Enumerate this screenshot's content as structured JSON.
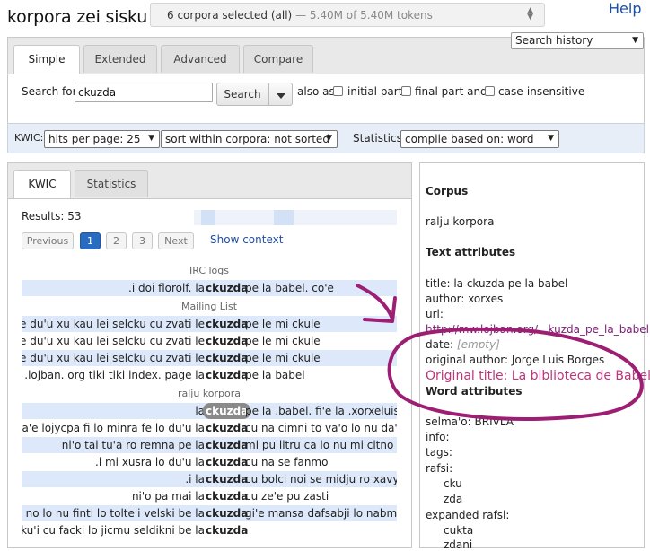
{
  "header": {
    "title": "korpora zei sisku",
    "corpus_selected": "6 corpora selected (all)",
    "corpus_tokens": "— 5.40M of 5.40M tokens",
    "help": "Help"
  },
  "search_history": {
    "label": "Search history"
  },
  "search_tabs": [
    "Simple",
    "Extended",
    "Advanced",
    "Compare"
  ],
  "search": {
    "label": "Search for",
    "value": "ckuzda",
    "button": "Search",
    "also_as": "also as",
    "opt_initial": "initial part",
    "opt_final": "final part and",
    "opt_case": "case-insensitive"
  },
  "options_bar": {
    "kwic_label": "KWIC:",
    "hits_per_page": "hits per page: 25",
    "sort": "sort within corpora: not sorted",
    "stats_label": "Statistics:",
    "stats": "compile based on: word"
  },
  "kwic_tabs": [
    "KWIC",
    "Statistics"
  ],
  "results": {
    "label": "Results: 53",
    "pagination": {
      "previous": "Previous",
      "pages": [
        "1",
        "2",
        "3"
      ],
      "active_page": "1",
      "next": "Next"
    },
    "show_context": "Show context"
  },
  "kwic_groups": [
    {
      "label": "IRC logs",
      "rows": [
        {
          "left": ".i doi florolf. la",
          "match": "ckuzda",
          "right": "pe la babel. co'e"
        }
      ]
    },
    {
      "label": "Mailing List",
      "rows": [
        {
          "left": "na le du'u xu kau lei selcku cu zvati le",
          "match": "ckuzda",
          "right": "pe le mi ckule"
        },
        {
          "left": "na le du'u xu kau lei selcku cu zvati le",
          "match": "ckuzda",
          "right": "pe le mi ckule"
        },
        {
          "left": "na le du'u xu kau lei selcku cu zvati le",
          "match": "ckuzda",
          "right": "pe le mi ckule"
        },
        {
          "left": "a'oi .lojban. org tiki tiki index. page la",
          "match": "ckuzda",
          "right": "pe la babel"
        }
      ]
    },
    {
      "label": "ralju korpora",
      "rows": [
        {
          "left": "la",
          "match": "ckuzda",
          "right": "pe la .babel. fi'e la .xorxeluis. bo"
        },
        {
          "left": "cu ta'e lojycpa fi lo minra fe lo du'u la",
          "match": "ckuzda",
          "right": "cu na cimni to va'o lo nu da'i ja"
        },
        {
          "left": "ni'o tai tu'a ro remna pe la",
          "match": "ckuzda",
          "right": "mi pu litru ca lo nu mi citno"
        },
        {
          "left": ".i mi xusra lo du'u la",
          "match": "ckuzda",
          "right": "cu na se fanmo"
        },
        {
          "left": ".i la",
          "match": "ckuzda",
          "right": "cu bolci noi se midju ro xavysel"
        },
        {
          "left": "ni'o pa mai la",
          "match": "ckuzda",
          "right": "cu ze'e pu zasti"
        },
        {
          "left": "ci no no lo nu finti lo tolte'i velski be la",
          "match": "ckuzda",
          "right": "gi'e mansa dafsabji lo nabmi po"
        },
        {
          "left": "zdaku'i cu facki lo jicmu seldikni be la",
          "match": "ckuzda",
          "right": ""
        }
      ]
    }
  ],
  "sidebar": {
    "corpus_heading": "Corpus",
    "corpus_value": "ralju korpora",
    "text_attrs_heading": "Text attributes",
    "title_line": "title: la ckuzda pe la babel",
    "author_line": "author: xorxes",
    "url_label": "url:",
    "url_value": "http://mw.lojban.org/...kuzda_pe_la_babel",
    "date_label": "date:",
    "date_value": "[empty]",
    "original_author_line": "original author: Jorge Luis Borges",
    "original_title_line": "Original title: La biblioteca de Babel",
    "word_attrs_heading": "Word attributes",
    "selmao_line": "selma'o: BRIVLA",
    "info_line": "info:",
    "tags_line": "tags:",
    "rafsi_label": "rafsi:",
    "rafsi_values": [
      "cku",
      "zda"
    ],
    "expanded_rafsi_label": "expanded rafsi:",
    "expanded_rafsi_values": [
      "cukta",
      "zdani"
    ]
  },
  "colors": {
    "accent": "#2a6bc2",
    "annotation": "#9c1f74",
    "kwic_highlight": "#dde9fa"
  }
}
